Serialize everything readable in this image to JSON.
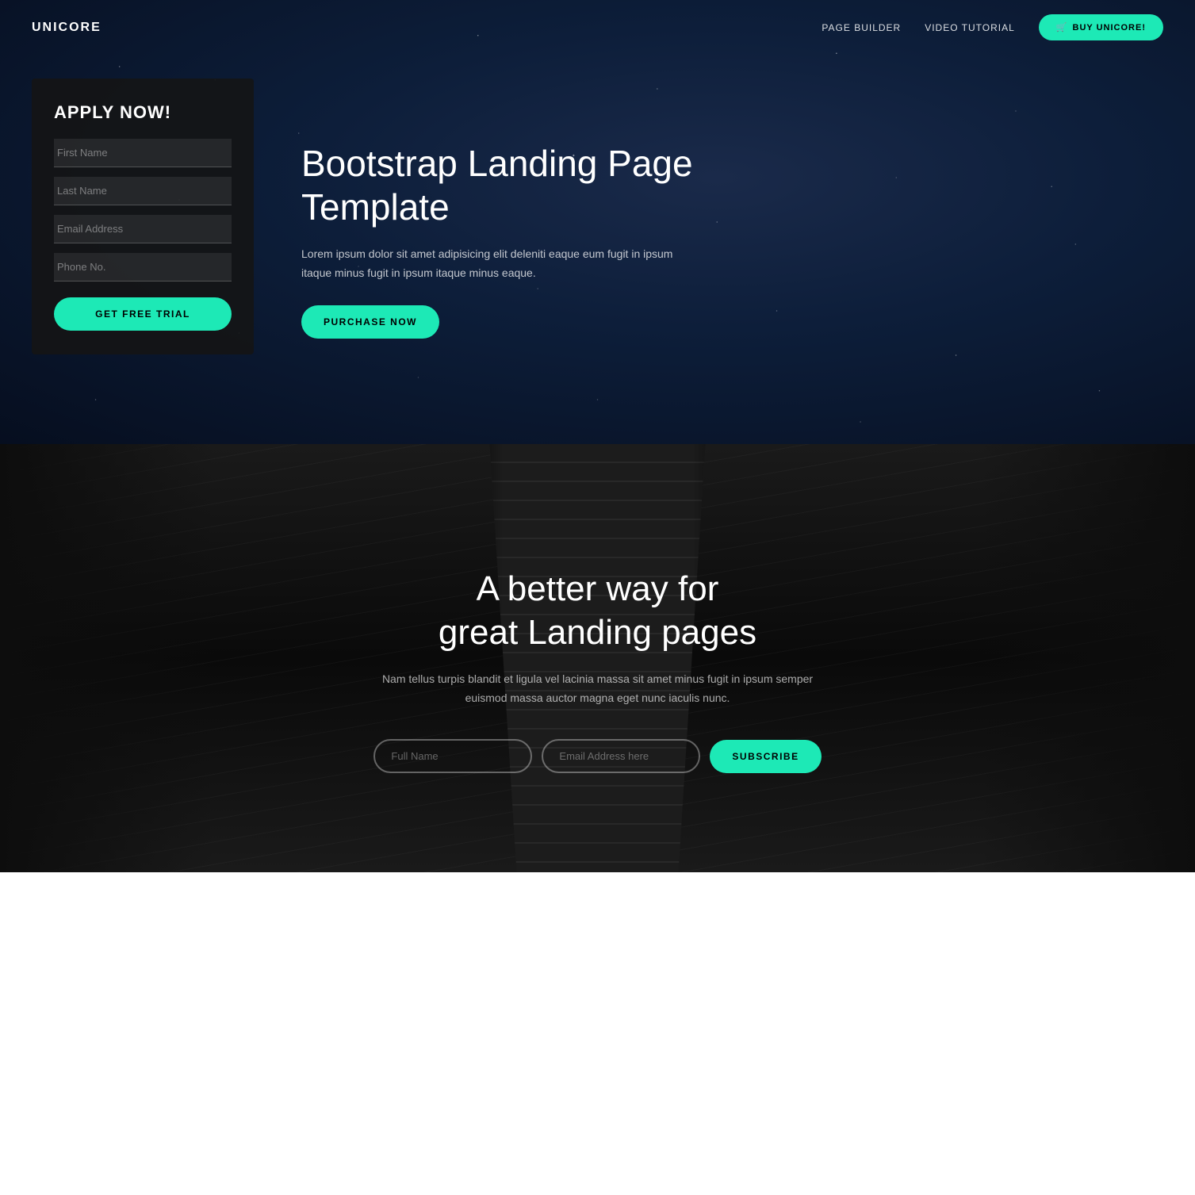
{
  "navbar": {
    "brand": "UNICORE",
    "links": [
      {
        "label": "PAGE BUILDER",
        "id": "page-builder-link"
      },
      {
        "label": "VIDEO TUTORIAL",
        "id": "video-tutorial-link"
      }
    ],
    "cta_icon": "🛒",
    "cta_label": "BUY UNICORE!"
  },
  "hero": {
    "form": {
      "title": "APPLY NOW!",
      "fields": [
        {
          "placeholder": "First Name",
          "id": "first-name-input",
          "type": "text"
        },
        {
          "placeholder": "Last Name",
          "id": "last-name-input",
          "type": "text"
        },
        {
          "placeholder": "Email Address",
          "id": "email-input",
          "type": "email"
        },
        {
          "placeholder": "Phone No.",
          "id": "phone-input",
          "type": "tel"
        }
      ],
      "submit_label": "GET FREE TRIAL"
    },
    "text": {
      "title": "Bootstrap Landing Page Template",
      "description": "Lorem ipsum dolor sit amet adipisicing elit deleniti eaque eum fugit in ipsum itaque minus fugit in ipsum itaque minus eaque.",
      "cta_label": "PURCHASE NOW"
    }
  },
  "escalator": {
    "title_line1": "A better way for",
    "title_line2": "great Landing pages",
    "description": "Nam tellus turpis blandit et ligula vel lacinia massa sit amet minus fugit in ipsum semper euismod massa auctor magna eget nunc iaculis nunc.",
    "subscribe": {
      "full_name_placeholder": "Full Name",
      "email_placeholder": "Email Address here",
      "button_label": "SUBSCRIBE"
    }
  },
  "colors": {
    "accent": "#1de9b6",
    "hero_bg": "#0a1628",
    "dark_section": "#111111"
  }
}
